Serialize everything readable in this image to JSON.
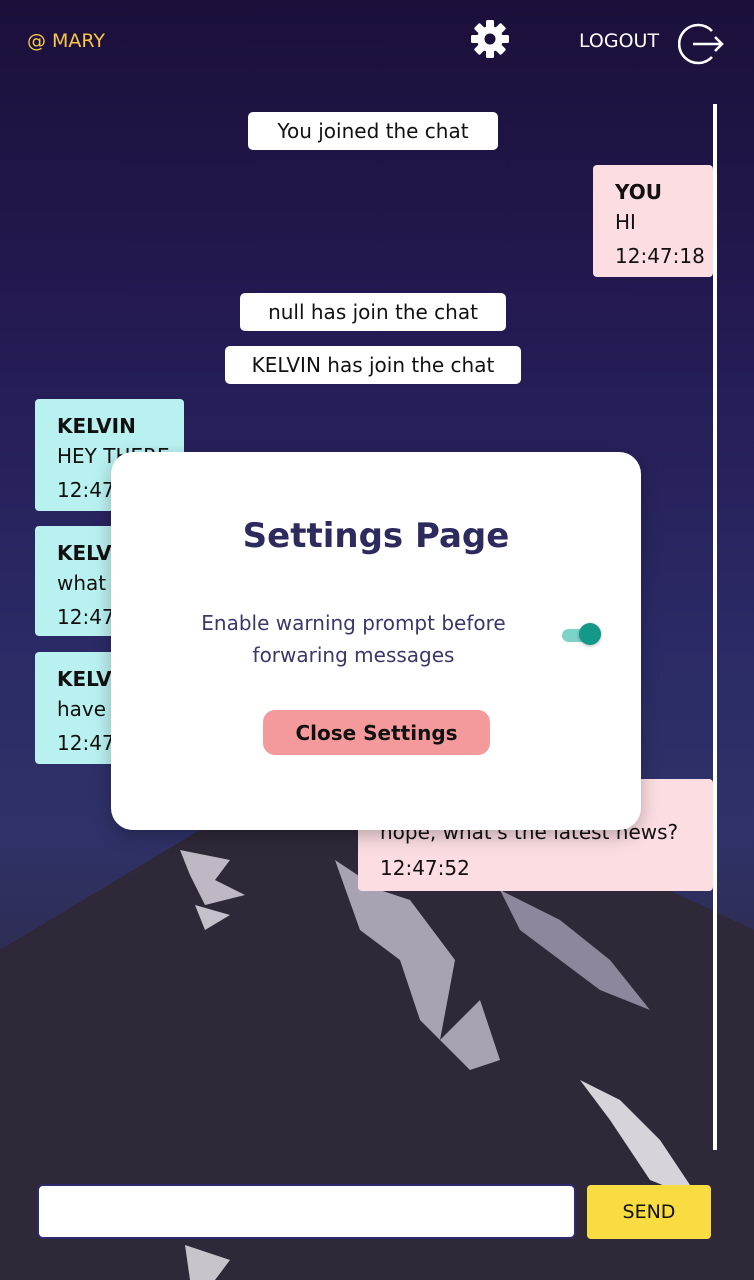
{
  "header": {
    "user_label": "@ MARY",
    "settings_icon": "gear-icon",
    "logout_label": "LOGOUT",
    "logout_icon": "logout-icon"
  },
  "messages": {
    "system": [
      "You joined the chat",
      "null has join the chat",
      "KELVIN has join the chat"
    ],
    "chat": [
      {
        "sender": "YOU",
        "text": "HI",
        "time": "12:47:18"
      },
      {
        "sender": "KELVIN",
        "text": "HEY THERE",
        "time": "12:47:"
      },
      {
        "sender": "KELVI",
        "text": "what",
        "time": "12:47:"
      },
      {
        "sender": "KELVI",
        "text": "have",
        "time": "12:47:"
      },
      {
        "sender": "",
        "text": "nope, what's the latest news?",
        "time": "12:47:52"
      }
    ]
  },
  "settings": {
    "title": "Settings Page",
    "option_label": "Enable warning prompt before forwaring messages",
    "option_enabled": true,
    "close_label": "Close Settings"
  },
  "composer": {
    "input_value": "",
    "send_label": "SEND"
  },
  "colors": {
    "user_label": "#f5c84a",
    "own_bubble": "#fbdde2",
    "other_bubble": "#b9f1f0",
    "send_button": "#f8dc42",
    "close_button": "#f59a9c",
    "toggle": "#13988a"
  }
}
